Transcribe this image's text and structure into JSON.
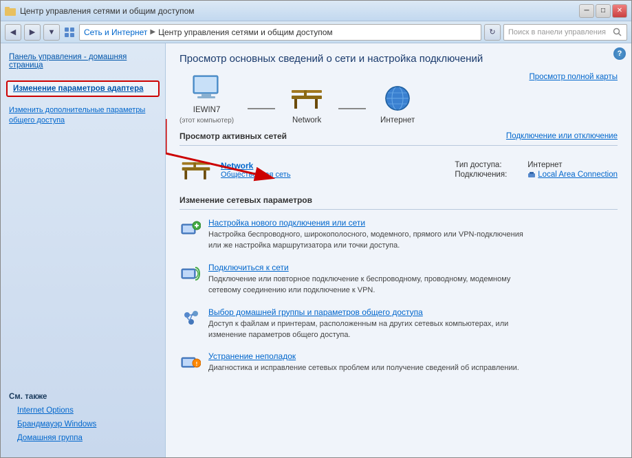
{
  "titlebar": {
    "title": "Центр управления сетями и общим доступом"
  },
  "addressbar": {
    "breadcrumb1": "Сеть и Интернет",
    "breadcrumb2": "Центр управления сетями и общим доступом",
    "search_placeholder": "Поиск в панели управления"
  },
  "sidebar": {
    "home_label": "Панель управления - домашняя страница",
    "change_adapter_label": "Изменение параметров адаптера",
    "change_sharing_label": "Изменить дополнительные параметры общего доступа",
    "see_also_title": "См. также",
    "see_also_items": [
      {
        "label": "Internet Options"
      },
      {
        "label": "Брандмауэр Windows"
      },
      {
        "label": "Домашняя группа"
      }
    ]
  },
  "content": {
    "title": "Просмотр основных сведений о сети и настройка подключений",
    "full_map_link": "Просмотр полной карты",
    "network_map": {
      "items": [
        {
          "label": "IEWIN7",
          "sublabel": "(этот компьютер)"
        },
        {
          "label": "Network",
          "sublabel": ""
        },
        {
          "label": "Интернет",
          "sublabel": ""
        }
      ]
    },
    "active_networks_title": "Просмотр активных сетей",
    "connect_disconnect_link": "Подключение или отключение",
    "network": {
      "name": "Network",
      "type": "Общественная сеть",
      "access_type_label": "Тип доступа:",
      "access_type_value": "Интернет",
      "connections_label": "Подключения:",
      "connections_value": "Local Area Connection"
    },
    "change_settings_title": "Изменение сетевых параметров",
    "settings": [
      {
        "link": "Настройка нового подключения или сети",
        "desc": "Настройка беспроводного, широкополосного, модемного, прямого или VPN-подключения\nили же настройка маршрутизатора или точки доступа."
      },
      {
        "link": "Подключиться к сети",
        "desc": "Подключение или повторное подключение к беспроводному, проводному, модемному\nсетевому соединению или подключение к VPN."
      },
      {
        "link": "Выбор домашней группы и параметров общего доступа",
        "desc": "Доступ к файлам и принтерам, расположенным на других сетевых компьютерах, или\nизменение параметров общего доступа."
      },
      {
        "link": "Устранение неполадок",
        "desc": "Диагностика и исправление сетевых проблем или получение сведений об исправлении."
      }
    ]
  },
  "colors": {
    "accent_blue": "#0066cc",
    "bg_sidebar": "#d0e0f0",
    "bg_content": "#eef3fa",
    "border": "#b0c0d8",
    "highlight_red": "#cc0000"
  }
}
